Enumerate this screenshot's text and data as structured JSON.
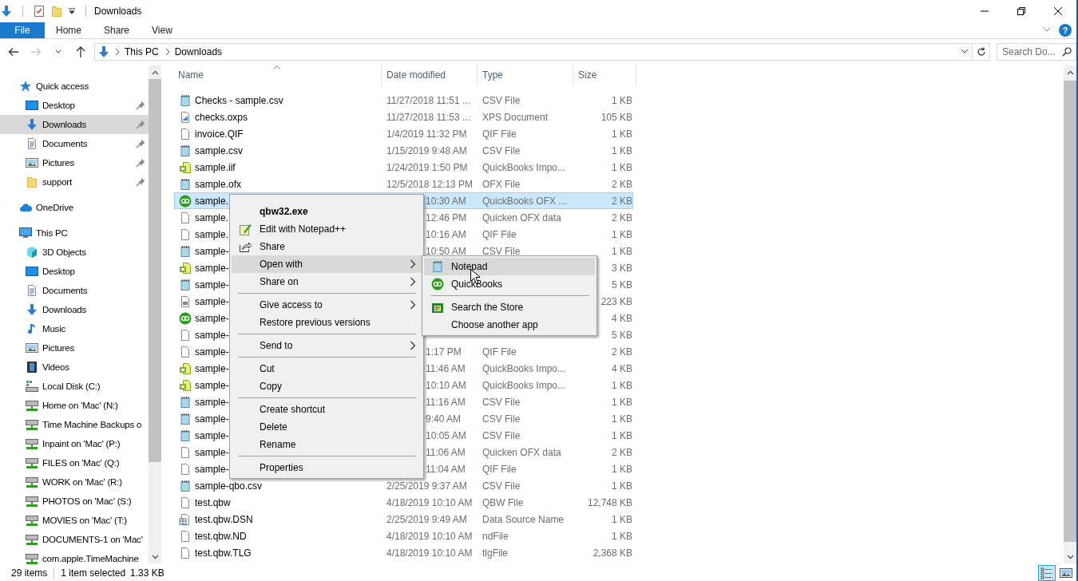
{
  "title_bar": {
    "title": "Downloads"
  },
  "ribbon": {
    "tabs": [
      {
        "label": "File",
        "kind": "file",
        "selected": false
      },
      {
        "label": "Home",
        "kind": "tab",
        "selected": false
      },
      {
        "label": "Share",
        "kind": "tab",
        "selected": false
      },
      {
        "label": "View",
        "kind": "tab",
        "selected": false
      }
    ],
    "help": "?"
  },
  "address_bar": {
    "nav": [
      {
        "kind": "back",
        "disabled": false
      },
      {
        "kind": "forward",
        "disabled": true
      }
    ],
    "path": [
      "This PC",
      "Downloads"
    ],
    "search_placeholder": "Search Do..."
  },
  "sidebar": {
    "items": [
      {
        "label": "Quick access",
        "kind": "star",
        "selected": false,
        "children": [
          {
            "label": "Desktop",
            "kind": "desktop",
            "pinned": true,
            "selected": false
          },
          {
            "label": "Downloads",
            "kind": "download",
            "pinned": true,
            "selected": true
          },
          {
            "label": "Documents",
            "kind": "documents",
            "pinned": true,
            "selected": false
          },
          {
            "label": "Pictures",
            "kind": "pictures",
            "pinned": true,
            "selected": false
          },
          {
            "label": "support",
            "kind": "folder",
            "pinned": true,
            "selected": false
          }
        ]
      },
      {
        "label": "OneDrive",
        "kind": "cloud",
        "selected": false
      },
      {
        "label": "This PC",
        "kind": "pc",
        "selected": false,
        "children": [
          {
            "label": "3D Objects",
            "kind": "cube",
            "selected": false
          },
          {
            "label": "Desktop",
            "kind": "desktop",
            "selected": false
          },
          {
            "label": "Documents",
            "kind": "documents",
            "selected": false
          },
          {
            "label": "Downloads",
            "kind": "download",
            "selected": false
          },
          {
            "label": "Music",
            "kind": "music",
            "selected": false
          },
          {
            "label": "Pictures",
            "kind": "pictures",
            "selected": false
          },
          {
            "label": "Videos",
            "kind": "film",
            "selected": false
          },
          {
            "label": "Local Disk (C:)",
            "kind": "disk",
            "selected": false
          },
          {
            "label": "Home on 'Mac' (N:)",
            "kind": "netdrive",
            "selected": false
          },
          {
            "label": "Time Machine Backups o",
            "kind": "netdrive",
            "selected": false
          },
          {
            "label": "Inpaint on 'Mac' (P:)",
            "kind": "netdrive",
            "selected": false
          },
          {
            "label": "FILES on 'Mac' (Q:)",
            "kind": "netdrive",
            "selected": false
          },
          {
            "label": "WORK on 'Mac' (R:)",
            "kind": "netdrive",
            "selected": false
          },
          {
            "label": "PHOTOS on 'Mac' (S:)",
            "kind": "netdrive",
            "selected": false
          },
          {
            "label": "MOVIES on 'Mac' (T:)",
            "kind": "netdrive",
            "selected": false
          },
          {
            "label": "DOCUMENTS-1 on 'Mac'",
            "kind": "netdrive",
            "selected": false
          },
          {
            "label": "com.apple.TimeMachine",
            "kind": "netdrive",
            "selected": false
          }
        ]
      }
    ]
  },
  "table": {
    "columns": [
      {
        "label": "Name",
        "sorted": true
      },
      {
        "label": "Date modified",
        "sorted": false
      },
      {
        "label": "Type",
        "sorted": false
      },
      {
        "label": "Size",
        "sorted": false
      }
    ],
    "rows": [
      {
        "kind": "notepad",
        "name": "Checks - sample.csv",
        "date": "11/27/2018 11:51 ...",
        "type": "CSV File",
        "size": "1 KB",
        "selected": false
      },
      {
        "kind": "xps",
        "name": "checks.oxps",
        "date": "11/27/2018 11:53 ...",
        "type": "XPS Document",
        "size": "105 KB",
        "selected": false
      },
      {
        "kind": "blank",
        "name": "invoice.QIF",
        "date": "1/4/2019 11:32 PM",
        "type": "QIF File",
        "size": "1 KB",
        "selected": false
      },
      {
        "kind": "notepad",
        "name": "sample.csv",
        "date": "1/15/2019 9:48 AM",
        "type": "CSV File",
        "size": "1 KB",
        "selected": false
      },
      {
        "kind": "iif",
        "name": "sample.iif",
        "date": "1/24/2019 1:50 PM",
        "type": "QuickBooks Impo...",
        "size": "1 KB",
        "selected": false
      },
      {
        "kind": "notepad",
        "name": "sample.ofx",
        "date": "12/5/2018 12:13 PM",
        "type": "OFX File",
        "size": "2 KB",
        "selected": false
      },
      {
        "kind": "qb",
        "name": "sample.",
        "date": "10:30 AM",
        "type": "QuickBooks OFX ...",
        "size": "2 KB",
        "selected": true
      },
      {
        "kind": "blank",
        "name": "sample.",
        "date": "12:46 PM",
        "type": "Quicken OFX data",
        "size": "2 KB",
        "selected": false
      },
      {
        "kind": "blank",
        "name": "sample.",
        "date": "10:16 AM",
        "type": "QIF File",
        "size": "1 KB",
        "selected": false
      },
      {
        "kind": "notepad",
        "name": "sample-",
        "date": "10:50 AM",
        "type": "CSV File",
        "size": "1 KB",
        "selected": false
      },
      {
        "kind": "iif",
        "name": "sample-",
        "size": "3 KB",
        "selected": false
      },
      {
        "kind": "notepad",
        "name": "sample-",
        "size": "5 KB",
        "selected": false
      },
      {
        "kind": "pdf",
        "name": "sample-",
        "size": "223 KB",
        "selected": false
      },
      {
        "kind": "qb",
        "name": "sample-",
        "size": "4 KB",
        "selected": false
      },
      {
        "kind": "blank",
        "name": "sample-",
        "size": "5 KB",
        "selected": false
      },
      {
        "kind": "blank",
        "name": "sample-",
        "date": "1:17 PM",
        "type": "QIF File",
        "size": "2 KB",
        "selected": false
      },
      {
        "kind": "iif",
        "name": "sample-",
        "date": "11:46 AM",
        "type": "QuickBooks Impo...",
        "size": "4 KB",
        "selected": false
      },
      {
        "kind": "iif",
        "name": "sample-",
        "date": "10:10 AM",
        "type": "QuickBooks Impo...",
        "size": "1 KB",
        "selected": false
      },
      {
        "kind": "notepad",
        "name": "sample-",
        "date": "11:16 AM",
        "type": "CSV File",
        "size": "1 KB",
        "selected": false
      },
      {
        "kind": "notepad",
        "name": "sample-",
        "date": "9:40 AM",
        "type": "CSV File",
        "size": "1 KB",
        "selected": false
      },
      {
        "kind": "notepad",
        "name": "sample-",
        "date": "10:05 AM",
        "type": "CSV File",
        "size": "1 KB",
        "selected": false
      },
      {
        "kind": "blank",
        "name": "sample-",
        "date": "11:06 AM",
        "type": "Quicken OFX data",
        "size": "2 KB",
        "selected": false
      },
      {
        "kind": "blank",
        "name": "sample-",
        "date": "11:04 AM",
        "type": "QIF File",
        "size": "1 KB",
        "selected": false
      },
      {
        "kind": "notepad",
        "name": "sample-qbo.csv",
        "date": "2/25/2019 9:37 AM",
        "type": "CSV File",
        "size": "1 KB",
        "selected": false
      },
      {
        "kind": "blank",
        "name": "test.qbw",
        "date": "4/18/2019 10:10 AM",
        "type": "QBW File",
        "size": "12,748 KB",
        "selected": false
      },
      {
        "kind": "dsn",
        "name": "test.qbw.DSN",
        "date": "2/25/2019 9:49 AM",
        "type": "Data Source Name",
        "size": "1 KB",
        "selected": false
      },
      {
        "kind": "blank",
        "name": "test.qbw.ND",
        "date": "4/18/2019 10:10 AM",
        "type": "ndFile",
        "size": "1 KB",
        "selected": false
      },
      {
        "kind": "blank",
        "name": "test.qbw.TLG",
        "date": "4/18/2019 10:10 AM",
        "type": "tlgFile",
        "size": "2,368 KB",
        "selected": false
      }
    ]
  },
  "context_menu": {
    "groups": [
      [
        {
          "label": "qbw32.exe",
          "kind": "default",
          "submenu": false,
          "selected": false
        },
        {
          "label": "Edit with Notepad++",
          "kind": "edit",
          "submenu": false,
          "selected": false
        },
        {
          "label": "Share",
          "kind": "share",
          "submenu": false,
          "selected": false
        },
        {
          "label": "Open with",
          "kind": "plain",
          "submenu": true,
          "selected": true
        },
        {
          "label": "Share on",
          "kind": "plain",
          "submenu": true,
          "selected": false
        }
      ],
      [
        {
          "label": "Give access to",
          "kind": "plain",
          "submenu": true,
          "selected": false
        },
        {
          "label": "Restore previous versions",
          "kind": "plain",
          "submenu": false,
          "selected": false
        }
      ],
      [
        {
          "label": "Send to",
          "kind": "plain",
          "submenu": true,
          "selected": false
        }
      ],
      [
        {
          "label": "Cut",
          "kind": "plain",
          "submenu": false,
          "selected": false
        },
        {
          "label": "Copy",
          "kind": "plain",
          "submenu": false,
          "selected": false
        }
      ],
      [
        {
          "label": "Create shortcut",
          "kind": "plain",
          "submenu": false,
          "selected": false
        },
        {
          "label": "Delete",
          "kind": "plain",
          "submenu": false,
          "selected": false
        },
        {
          "label": "Rename",
          "kind": "plain",
          "submenu": false,
          "selected": false
        }
      ],
      [
        {
          "label": "Properties",
          "kind": "plain",
          "submenu": false,
          "selected": false
        }
      ]
    ]
  },
  "open_with_menu": {
    "groups": [
      [
        {
          "label": "Notepad",
          "kind": "notepad",
          "selected": true
        },
        {
          "label": "QuickBooks",
          "kind": "qb",
          "selected": false
        }
      ],
      [
        {
          "label": "Search the Store",
          "kind": "store",
          "selected": false
        },
        {
          "label": "Choose another app",
          "kind": "plain",
          "selected": false
        }
      ]
    ]
  },
  "status_bar": {
    "count": "29 items",
    "selection": "1 item selected",
    "size": "1.33 KB",
    "views": [
      {
        "kind": "details",
        "selected": true
      },
      {
        "kind": "large",
        "selected": false
      }
    ]
  }
}
